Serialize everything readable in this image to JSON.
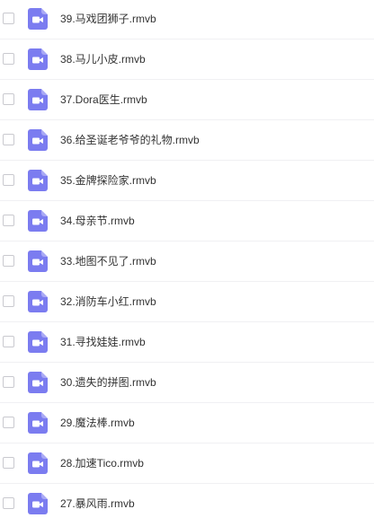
{
  "file_list": {
    "icon": "video-file-icon",
    "icon_color": "#7b7cf0",
    "items": [
      {
        "name": "39.马戏团狮子.rmvb"
      },
      {
        "name": "38.马儿小皮.rmvb"
      },
      {
        "name": "37.Dora医生.rmvb"
      },
      {
        "name": "36.给圣诞老爷爷的礼物.rmvb"
      },
      {
        "name": "35.金牌探险家.rmvb"
      },
      {
        "name": "34.母亲节.rmvb"
      },
      {
        "name": "33.地图不见了.rmvb"
      },
      {
        "name": "32.消防车小红.rmvb"
      },
      {
        "name": "31.寻找娃娃.rmvb"
      },
      {
        "name": "30.遗失的拼图.rmvb"
      },
      {
        "name": "29.魔法棒.rmvb"
      },
      {
        "name": "28.加速Tico.rmvb"
      },
      {
        "name": "27.暴风雨.rmvb"
      }
    ]
  }
}
